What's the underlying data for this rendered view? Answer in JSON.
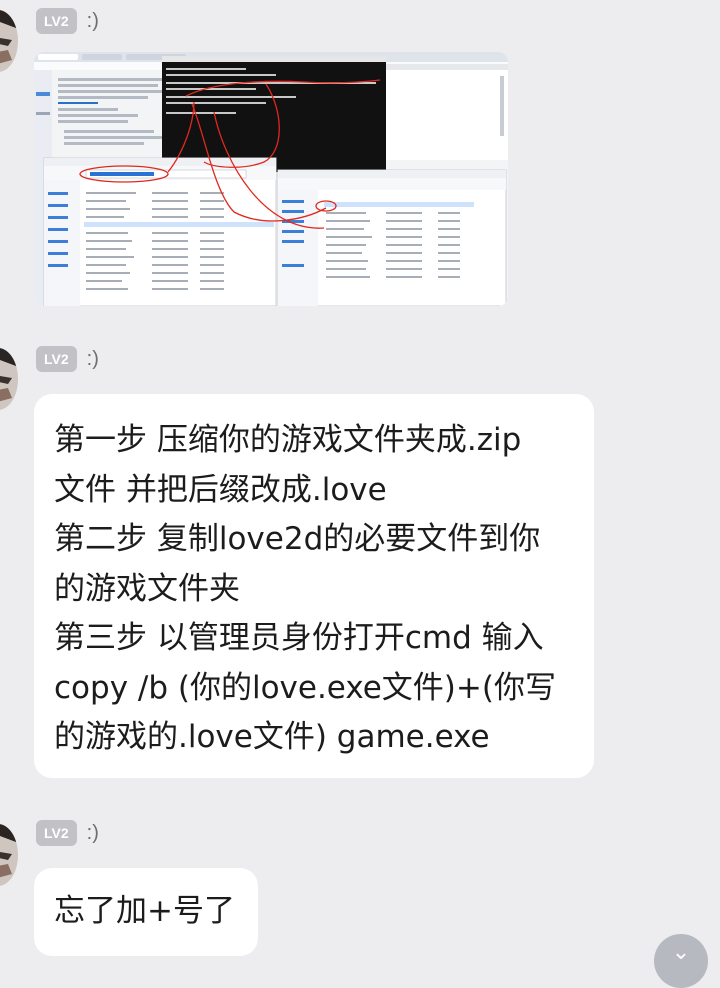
{
  "messages": [
    {
      "type": "image",
      "badge": "LV2",
      "nick": ":)"
    },
    {
      "type": "text",
      "badge": "LV2",
      "nick": ":)",
      "lines": [
        "第一步 压缩你的游戏文件夹成.zip",
        "文件 并把后缀改成.love",
        "第二步 复制love2d的必要文件到你",
        "的游戏文件夹",
        "第三步 以管理员身份打开cmd 输入",
        "copy /b (你的love.exe文件)+(你写",
        "的游戏的.love文件) game.exe"
      ]
    },
    {
      "type": "text",
      "badge": "LV2",
      "nick": ":)",
      "lines": [
        "忘了加+号了"
      ]
    }
  ],
  "fab": {
    "icon": "chevron-down-icon"
  },
  "colors": {
    "background": "#ededef",
    "badge": "#c2c2c6",
    "bubble": "#ffffff",
    "annotation": "#e0281e"
  }
}
